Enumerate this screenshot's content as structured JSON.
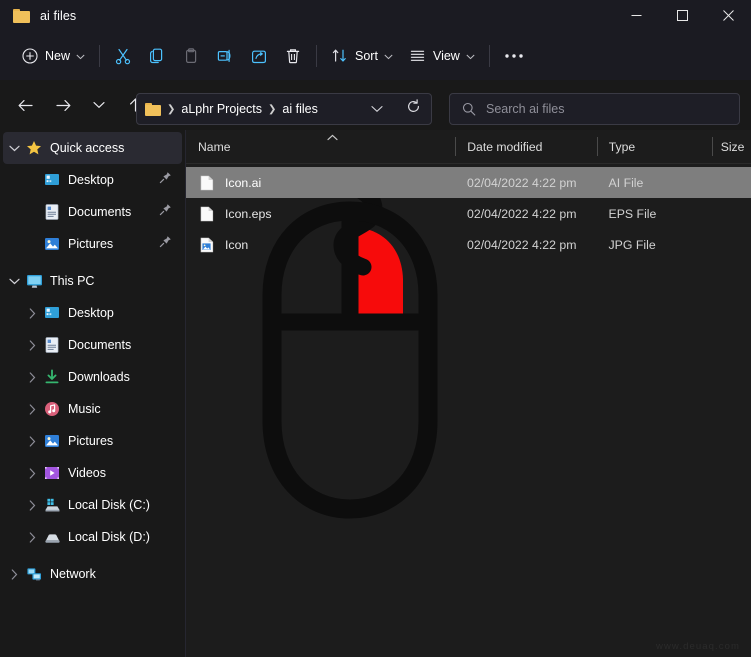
{
  "window": {
    "title": "ai files",
    "folder_icon": "folder-icon",
    "controls": {
      "minimize": "minimize-icon",
      "maximize": "maximize-icon",
      "close": "close-icon"
    }
  },
  "toolbar": {
    "new_label": "New",
    "sort_label": "Sort",
    "view_label": "View",
    "items": [
      {
        "name": "new-button",
        "icon": "plus-circle-icon",
        "label": "New",
        "caret": true
      },
      {
        "name": "cut-button",
        "icon": "scissors-icon",
        "label": "",
        "caret": false
      },
      {
        "name": "copy-button",
        "icon": "copy-icon",
        "label": "",
        "caret": false
      },
      {
        "name": "paste-button",
        "icon": "clipboard-icon",
        "label": "",
        "caret": false
      },
      {
        "name": "rename-button",
        "icon": "rename-icon",
        "label": "",
        "caret": false
      },
      {
        "name": "share-button",
        "icon": "share-icon",
        "label": "",
        "caret": false
      },
      {
        "name": "delete-button",
        "icon": "trash-icon",
        "label": "",
        "caret": false
      },
      {
        "name": "sort-button",
        "icon": "sort-arrows-icon",
        "label": "Sort",
        "caret": true
      },
      {
        "name": "view-button",
        "icon": "view-lines-icon",
        "label": "View",
        "caret": true
      },
      {
        "name": "more-button",
        "icon": "ellipsis-icon",
        "label": "",
        "caret": false
      }
    ]
  },
  "address": {
    "back_icon": "arrow-left-icon",
    "forward_icon": "arrow-right-icon",
    "recent_icon": "chevron-down-icon",
    "up_icon": "arrow-up-icon",
    "breadcrumbs": [
      "aLphr Projects",
      "ai files"
    ],
    "dropdown_icon": "chevron-down-icon",
    "refresh_icon": "refresh-icon"
  },
  "search": {
    "icon": "search-icon",
    "placeholder": "Search ai files",
    "value": ""
  },
  "sidebar": {
    "groups": [
      {
        "name": "quick-access",
        "header": {
          "label": "Quick access",
          "icon": "star-icon",
          "expanded": true,
          "active": true
        },
        "items": [
          {
            "label": "Desktop",
            "icon": "desktop-icon",
            "pinned": true
          },
          {
            "label": "Documents",
            "icon": "documents-icon",
            "pinned": true
          },
          {
            "label": "Pictures",
            "icon": "pictures-icon",
            "pinned": true
          }
        ]
      },
      {
        "name": "this-pc",
        "header": {
          "label": "This PC",
          "icon": "monitor-icon",
          "expanded": true,
          "active": false
        },
        "items": [
          {
            "label": "Desktop",
            "icon": "desktop-icon",
            "pinned": false
          },
          {
            "label": "Documents",
            "icon": "documents-icon",
            "pinned": false
          },
          {
            "label": "Downloads",
            "icon": "download-icon",
            "pinned": false
          },
          {
            "label": "Music",
            "icon": "music-icon",
            "pinned": false
          },
          {
            "label": "Pictures",
            "icon": "pictures-icon",
            "pinned": false
          },
          {
            "label": "Videos",
            "icon": "video-icon",
            "pinned": false
          },
          {
            "label": "Local Disk (C:)",
            "icon": "windows-disk-icon",
            "pinned": false
          },
          {
            "label": "Local Disk (D:)",
            "icon": "disk-icon",
            "pinned": false
          }
        ]
      },
      {
        "name": "network",
        "header": {
          "label": "Network",
          "icon": "network-icon",
          "expanded": false,
          "active": false
        },
        "items": []
      }
    ]
  },
  "file_list": {
    "columns": [
      {
        "key": "name",
        "label": "Name",
        "sorted": true,
        "sort_dir": "asc"
      },
      {
        "key": "date",
        "label": "Date modified",
        "sorted": false
      },
      {
        "key": "type",
        "label": "Type",
        "sorted": false
      },
      {
        "key": "size",
        "label": "Size",
        "sorted": false
      }
    ],
    "rows": [
      {
        "name": "Icon.ai",
        "date": "02/04/2022 4:22 pm",
        "type": "AI File",
        "size": "",
        "icon": "generic-file-icon",
        "selected": true
      },
      {
        "name": "Icon.eps",
        "date": "02/04/2022 4:22 pm",
        "type": "EPS File",
        "size": "",
        "icon": "generic-file-icon",
        "selected": false
      },
      {
        "name": "Icon",
        "date": "02/04/2022 4:22 pm",
        "type": "JPG File",
        "size": "",
        "icon": "image-file-icon",
        "selected": false
      }
    ]
  },
  "illustration": {
    "name": "computer-mouse-right-click-illustration",
    "outline_color": "#0d0d0d",
    "highlight_color": "#f70b0b"
  },
  "watermark": {
    "text": "www.deuaq.com"
  },
  "colors": {
    "window_bg": "#191919",
    "chrome_bg": "#1b1b22",
    "content_bg": "#1c1c1c",
    "accent_blue": "#4cc2ff",
    "selection_gray": "#7e7e7e",
    "folder_yellow": "#f0c05a"
  }
}
